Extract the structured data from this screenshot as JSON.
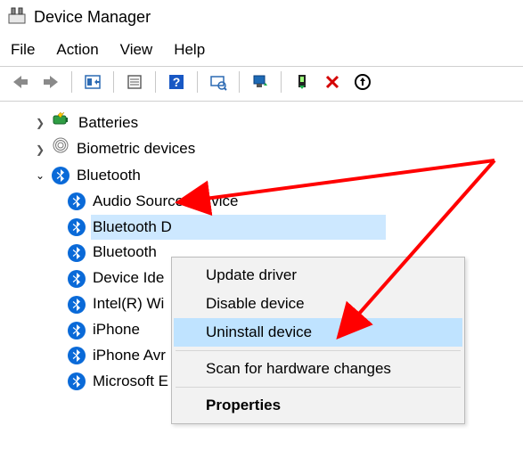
{
  "window": {
    "title": "Device Manager"
  },
  "menu": {
    "file": "File",
    "action": "Action",
    "view": "View",
    "help": "Help"
  },
  "tree": {
    "batteries": "Batteries",
    "biometric": "Biometric devices",
    "bluetooth": "Bluetooth",
    "bt_children": {
      "audio_source": "Audio Source Service",
      "bt_device_selected": "Bluetooth D",
      "bt_generic": "Bluetooth",
      "device_id": "Device Ide",
      "intel_wi": "Intel(R) Wi",
      "iphone": "iPhone",
      "iphone_avr": "iPhone Avr",
      "microsoft": "Microsoft E"
    }
  },
  "context_menu": {
    "update": "Update driver",
    "disable": "Disable device",
    "uninstall": "Uninstall device",
    "scan": "Scan for hardware changes",
    "properties": "Properties"
  }
}
